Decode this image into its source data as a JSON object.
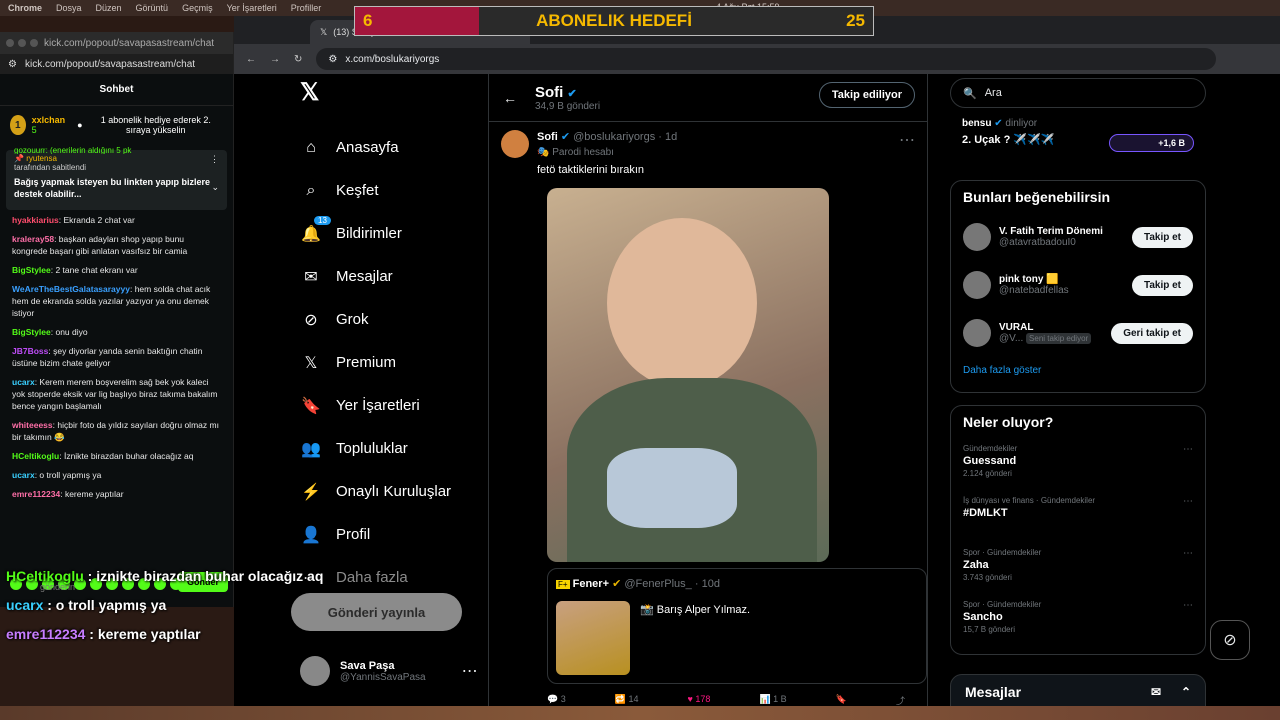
{
  "menubar": {
    "items": [
      "Chrome",
      "Dosya",
      "Düzen",
      "Görüntü",
      "Geçmiş",
      "Yer İşaretleri",
      "Profiller"
    ],
    "clock": "4 Ağu Pzt 15:59"
  },
  "goal": {
    "current": "6",
    "label": "ABONELIK HEDEFİ",
    "target": "25",
    "progress": 0.24,
    "fill_color": "#a3163c",
    "text_color": "#f6b900"
  },
  "chat": {
    "window_url_title": "kick.com/popout/savapasastream/chat",
    "url": "kick.com/popout/savapasastream/chat",
    "header": "Sohbet",
    "gift": {
      "rank": "1",
      "user": "xxlchan",
      "count": "5",
      "text": "1 abonelik hediye ederek 2. sıraya yükselin"
    },
    "pinned": {
      "partial_top": "gozouurr: (enerilerin aldığını 5 pk",
      "user": "ryutensa",
      "by": "tarafından sabitlendi",
      "text": "Bağış yapmak isteyen bu linkten yapıp bizlere destek olabilir..."
    },
    "messages": [
      {
        "user": "hyakkiarius",
        "text": ": Ekranda 2 chat var",
        "color": "#ff4d6d"
      },
      {
        "user": "kraleray58",
        "text": ": başkan adayları shop yapıp bunu kongrede başarı gibi anlatan vasıfsız bir camia",
        "color": "#ff6fa8"
      },
      {
        "user": "BigStylee",
        "text": ": 2 tane chat ekranı var",
        "color": "#53fc18"
      },
      {
        "user": "WeAreTheBestGalatasarayyy",
        "text": ": hem solda chat acık hem de ekranda solda yazılar yazıyor ya onu demek istiyor",
        "color": "#3aa0ff"
      },
      {
        "user": "BigStylee",
        "text": ": onu diyo",
        "color": "#53fc18"
      },
      {
        "user": "JB7Boss",
        "text": ": şey diyorlar yanda senin baktığın chatin üstüne bizim chate geliyor",
        "color": "#c04df9"
      },
      {
        "user": "ucarx",
        "text": ": Kerem merem boşverelim sağ bek yok kaleci yok stoperde eksik var lig başlıyo biraz takıma bakalım bence yangın başlamalı",
        "color": "#3ad0ff"
      },
      {
        "user": "whiteeess",
        "text": ": hiçbir foto da yıldız sayıları doğru olmaz mı bir takımın 😂",
        "color": "#ff6fa8"
      },
      {
        "user": "HCeltikoglu",
        "text": ": İznikte birazdan buhar olacağız aq",
        "color": "#53fc18"
      },
      {
        "user": "ucarx",
        "text": ": o troll yapmış ya",
        "color": "#3ad0ff"
      },
      {
        "user": "emre112234",
        "text": ": kereme yaptılar",
        "color": "#ff6fa8"
      }
    ],
    "send_label": "Gönder",
    "input_placeholder": "gönderin"
  },
  "overlay": [
    {
      "user": "HCeltikoglu",
      "text": " : iznikte birazdan buhar olacağız aq",
      "color": "#53fc18"
    },
    {
      "user": "ucarx",
      "text": " : o troll yapmış ya",
      "color": "#3ad0ff"
    },
    {
      "user": "emre112234",
      "text": " : kereme yaptılar",
      "color": "#c77dff"
    }
  ],
  "browser": {
    "tab_title": "(13) Sofi (",
    "url": "x.com/boslukariyorgs"
  },
  "nav": {
    "items": [
      {
        "label": "Anasayfa",
        "icon": "home-icon"
      },
      {
        "label": "Keşfet",
        "icon": "search-icon"
      },
      {
        "label": "Bildirimler",
        "icon": "bell-icon",
        "badge": "13"
      },
      {
        "label": "Mesajlar",
        "icon": "mail-icon"
      },
      {
        "label": "Grok",
        "icon": "grok-icon"
      },
      {
        "label": "Premium",
        "icon": "x-icon"
      },
      {
        "label": "Yer İşaretleri",
        "icon": "bookmark-icon"
      },
      {
        "label": "Topluluklar",
        "icon": "people-icon"
      },
      {
        "label": "Onaylı Kuruluşlar",
        "icon": "bolt-icon"
      },
      {
        "label": "Profil",
        "icon": "person-icon"
      },
      {
        "label": "Daha fazla",
        "icon": "more-icon"
      }
    ],
    "post_button": "Gönderi yayınla",
    "account_name": "Sava Paşa",
    "account_handle": "@YannisSavaPasa"
  },
  "profile": {
    "name": "Sofi",
    "post_count": "34,9 B gönderi",
    "follow_label": "Takip ediliyor"
  },
  "tweet": {
    "name": "Sofi",
    "handle": "@boslukariyorgs",
    "time": "1d",
    "parody": "Parodi hesabı",
    "text": "fetö taktiklerini bırakın",
    "quote": {
      "name": "Fener+",
      "handle": "@FenerPlus_",
      "time": "10d",
      "text": "📸 Barış Alper Yılmaz."
    },
    "replies": "3",
    "retweets": "14",
    "likes": "178",
    "views": "1 B"
  },
  "right": {
    "search_placeholder": "Ara",
    "top_post": {
      "user": "bensu",
      "suffix": "dinliyor",
      "text": "2. Uçak ? ✈️✈️✈️",
      "listeners": "+1,6 B"
    },
    "suggest_title": "Bunları beğenebilirsin",
    "suggestions": [
      {
        "name": "V. Fatih Terim Dönemi",
        "handle": "@atavratbadouI0",
        "btn": "Takip et"
      },
      {
        "name": "pink tony 🟨",
        "handle": "@natebadfellas",
        "btn": "Takip et"
      },
      {
        "name": "VURAL",
        "handle": "@V...",
        "extra": "Seni takip ediyor",
        "btn": "Geri takip et"
      }
    ],
    "show_more": "Daha fazla göster",
    "trends_title": "Neler oluyor?",
    "trends": [
      {
        "cat": "Gündemdekiler",
        "title": "Guessand",
        "count": "2.124 gönderi"
      },
      {
        "cat": "İş dünyası ve finans · Gündemdekiler",
        "title": "#DMLKT",
        "count": ""
      },
      {
        "cat": "Spor · Gündemdekiler",
        "title": "Zaha",
        "count": "3.743 gönderi"
      },
      {
        "cat": "Spor · Gündemdekiler",
        "title": "Sancho",
        "count": "15,7 B gönderi"
      }
    ],
    "dm_label": "Mesajlar"
  }
}
